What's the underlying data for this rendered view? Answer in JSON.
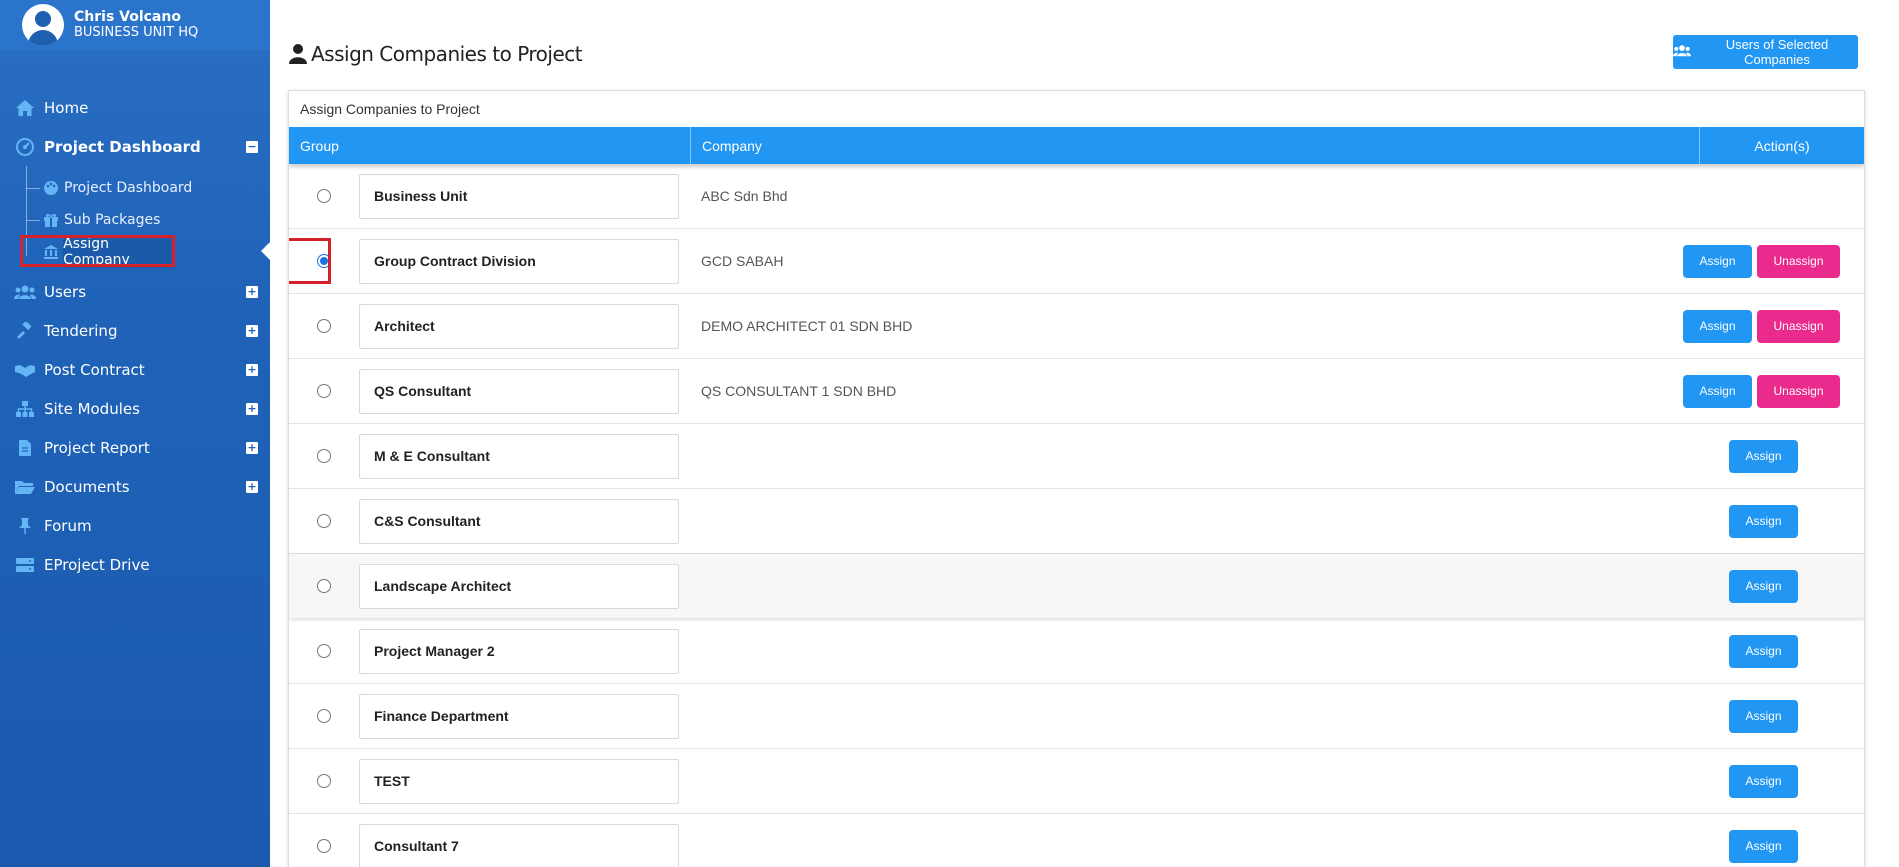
{
  "profile": {
    "name": "Chris Volcano",
    "unit": "BUSINESS UNIT HQ"
  },
  "sidebar": {
    "items": [
      {
        "label": "Home",
        "icon": "home-icon"
      },
      {
        "label": "Project Dashboard",
        "icon": "dashboard-icon",
        "toggle": "−"
      },
      {
        "label": "Users",
        "icon": "users-icon",
        "toggle": "+"
      },
      {
        "label": "Tendering",
        "icon": "gavel-icon",
        "toggle": "+"
      },
      {
        "label": "Post Contract",
        "icon": "handshake-icon",
        "toggle": "+"
      },
      {
        "label": "Site Modules",
        "icon": "sitemap-icon",
        "toggle": "+"
      },
      {
        "label": "Project Report",
        "icon": "file-icon",
        "toggle": "+"
      },
      {
        "label": "Documents",
        "icon": "folder-icon",
        "toggle": "+"
      },
      {
        "label": "Forum",
        "icon": "pin-icon"
      },
      {
        "label": "EProject Drive",
        "icon": "drive-icon"
      }
    ],
    "submenu": [
      {
        "label": "Project Dashboard",
        "icon": "palette-icon"
      },
      {
        "label": "Sub Packages",
        "icon": "gift-icon"
      },
      {
        "label": "Assign Company",
        "icon": "bank-icon"
      }
    ]
  },
  "page": {
    "title": "Assign Companies to Project",
    "users_button": "Users of Selected Companies"
  },
  "card": {
    "title": "Assign Companies to Project",
    "columns": [
      "Group",
      "Company",
      "Action(s)"
    ]
  },
  "buttons": {
    "assign": "Assign",
    "unassign": "Unassign"
  },
  "rows": [
    {
      "group": "Business Unit",
      "company": "ABC Sdn Bhd",
      "actions": "none",
      "checked": false
    },
    {
      "group": "Group Contract Division",
      "company": "GCD SABAH",
      "actions": "both",
      "checked": true
    },
    {
      "group": "Architect",
      "company": "DEMO ARCHITECT 01 SDN BHD",
      "actions": "both",
      "checked": false
    },
    {
      "group": "QS Consultant",
      "company": "QS CONSULTANT 1 SDN BHD",
      "actions": "both",
      "checked": false
    },
    {
      "group": "M & E Consultant",
      "company": "",
      "actions": "assign",
      "checked": false
    },
    {
      "group": "C&S Consultant",
      "company": "",
      "actions": "assign",
      "checked": false
    },
    {
      "group": "Landscape Architect",
      "company": "",
      "actions": "assign",
      "checked": false
    },
    {
      "group": "Project Manager 2",
      "company": "",
      "actions": "assign",
      "checked": false
    },
    {
      "group": "Finance Department",
      "company": "",
      "actions": "assign",
      "checked": false
    },
    {
      "group": "TEST",
      "company": "",
      "actions": "assign",
      "checked": false
    },
    {
      "group": "Consultant 7",
      "company": "",
      "actions": "assign",
      "checked": false
    }
  ]
}
